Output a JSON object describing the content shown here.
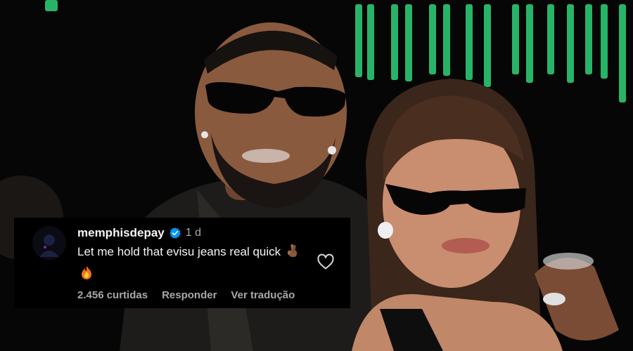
{
  "photo": {
    "icon": "photo-two-people-sunglasses",
    "background_color": "#050505",
    "accent_color": "#2fd37a"
  },
  "comment": {
    "avatar_icon": "avatar-icon",
    "username": "memphisdepay",
    "verified_icon": "verified-badge-icon",
    "verified_color": "#0095f6",
    "age": "1 d",
    "text": "Let me hold that evisu jeans real quick",
    "emojis": [
      "crossed-fingers-icon",
      "fire-icon"
    ],
    "like_icon": "heart-icon",
    "likes": "2.456 curtidas",
    "reply_label": "Responder",
    "translate_label": "Ver tradução"
  }
}
